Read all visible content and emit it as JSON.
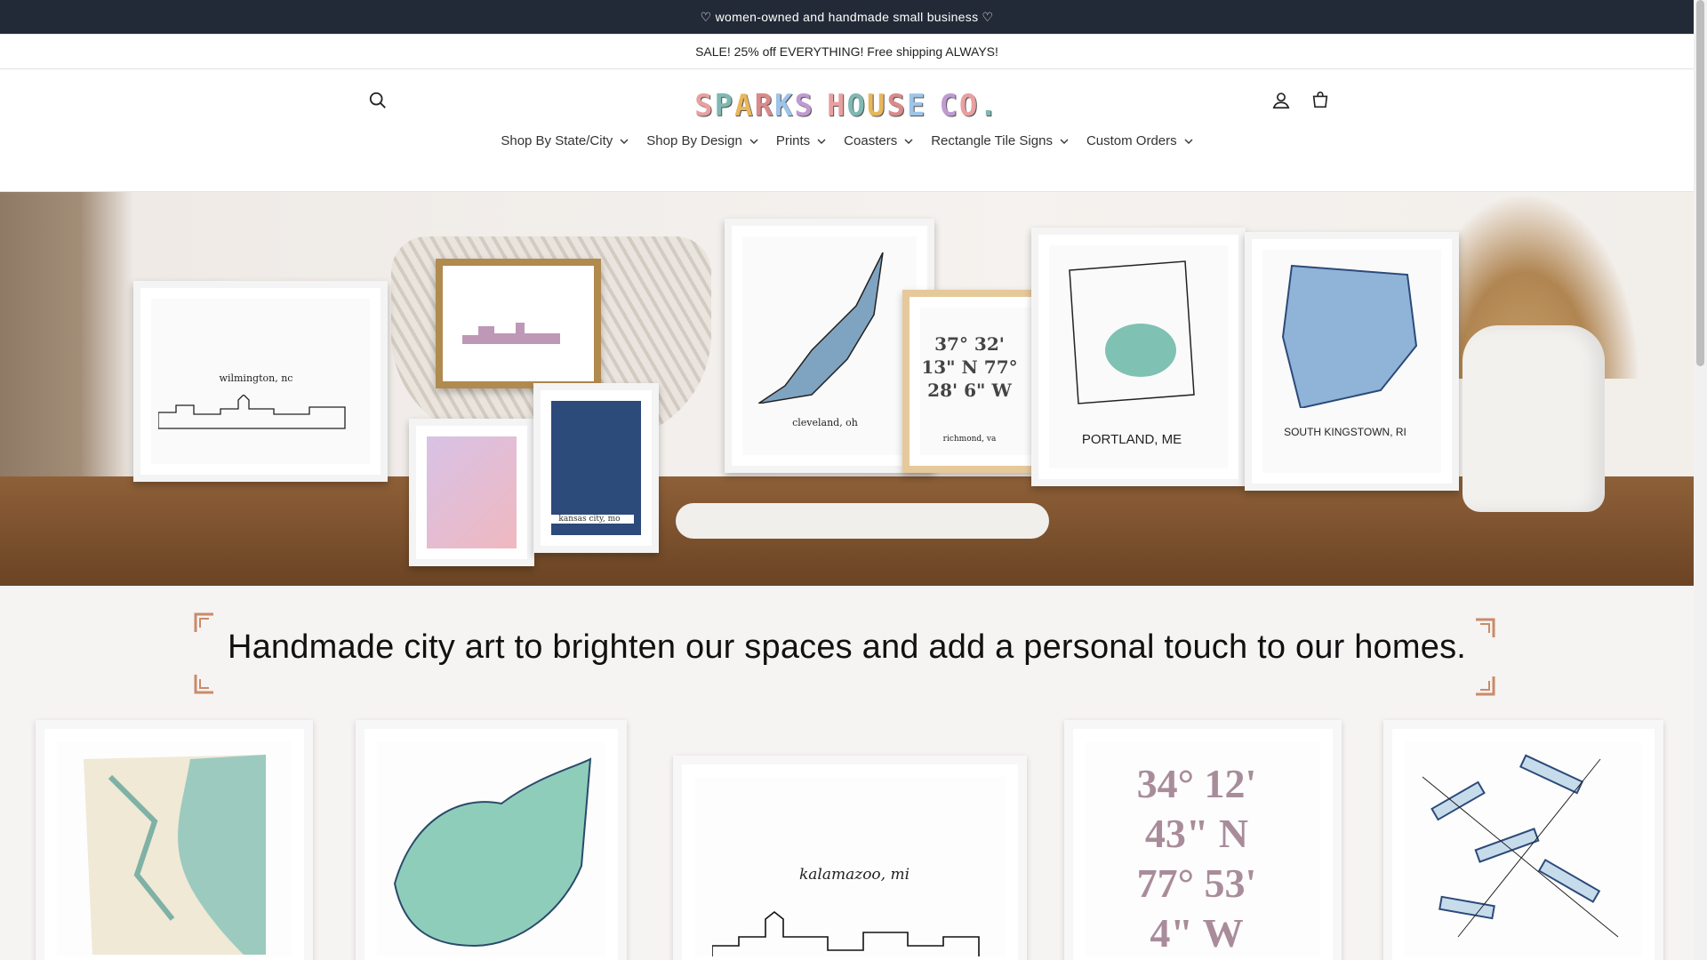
{
  "announcements": {
    "top": "♡ women-owned and handmade small business ♡",
    "sale": "SALE! 25% off EVERYTHING! Free shipping ALWAYS!"
  },
  "header": {
    "logo_text": "SPARKS HOUSE CO.",
    "logo_colors": [
      "#e9a0a0",
      "#7fb8b3",
      "#e8b75c",
      "#d98a8a",
      "#9ec5e8",
      "#c09ad1",
      "#e9a0a0",
      "#7fb8b3",
      "#e8b75c",
      "#d98a8a",
      "#9ec5e8",
      "#c09ad1",
      "#e9a0a0",
      "#7fb8b3",
      "#e8b75c",
      "#d98a8a"
    ],
    "icons": {
      "search": "search-icon",
      "account": "account-icon",
      "cart": "cart-icon"
    }
  },
  "nav": {
    "items": [
      {
        "label": "Shop By State/City"
      },
      {
        "label": "Shop By Design"
      },
      {
        "label": "Prints"
      },
      {
        "label": "Coasters"
      },
      {
        "label": "Rectangle Tile Signs"
      },
      {
        "label": "Custom Orders"
      }
    ]
  },
  "hero": {
    "frame_labels": [
      "wilmington, nc",
      "kansas city, mo",
      "cleveland, oh",
      "37° 32' 13\" N 77° 28' 6\" W",
      "richmond, va",
      "PORTLAND, ME",
      "SOUTH KINGSTOWN, RI"
    ]
  },
  "tagline": "Handmade city art to brighten our spaces and add a personal touch to our homes.",
  "colors": {
    "announce_bg": "#232a37",
    "accent_corner": "#c98b6a",
    "map_teal": "#7fc1b3",
    "map_navy": "#2c4a7a"
  },
  "products": {
    "card_labels": [
      "kalamazoo, mi",
      "34° 12' 43\" N 77° 53' 4\" W"
    ]
  }
}
